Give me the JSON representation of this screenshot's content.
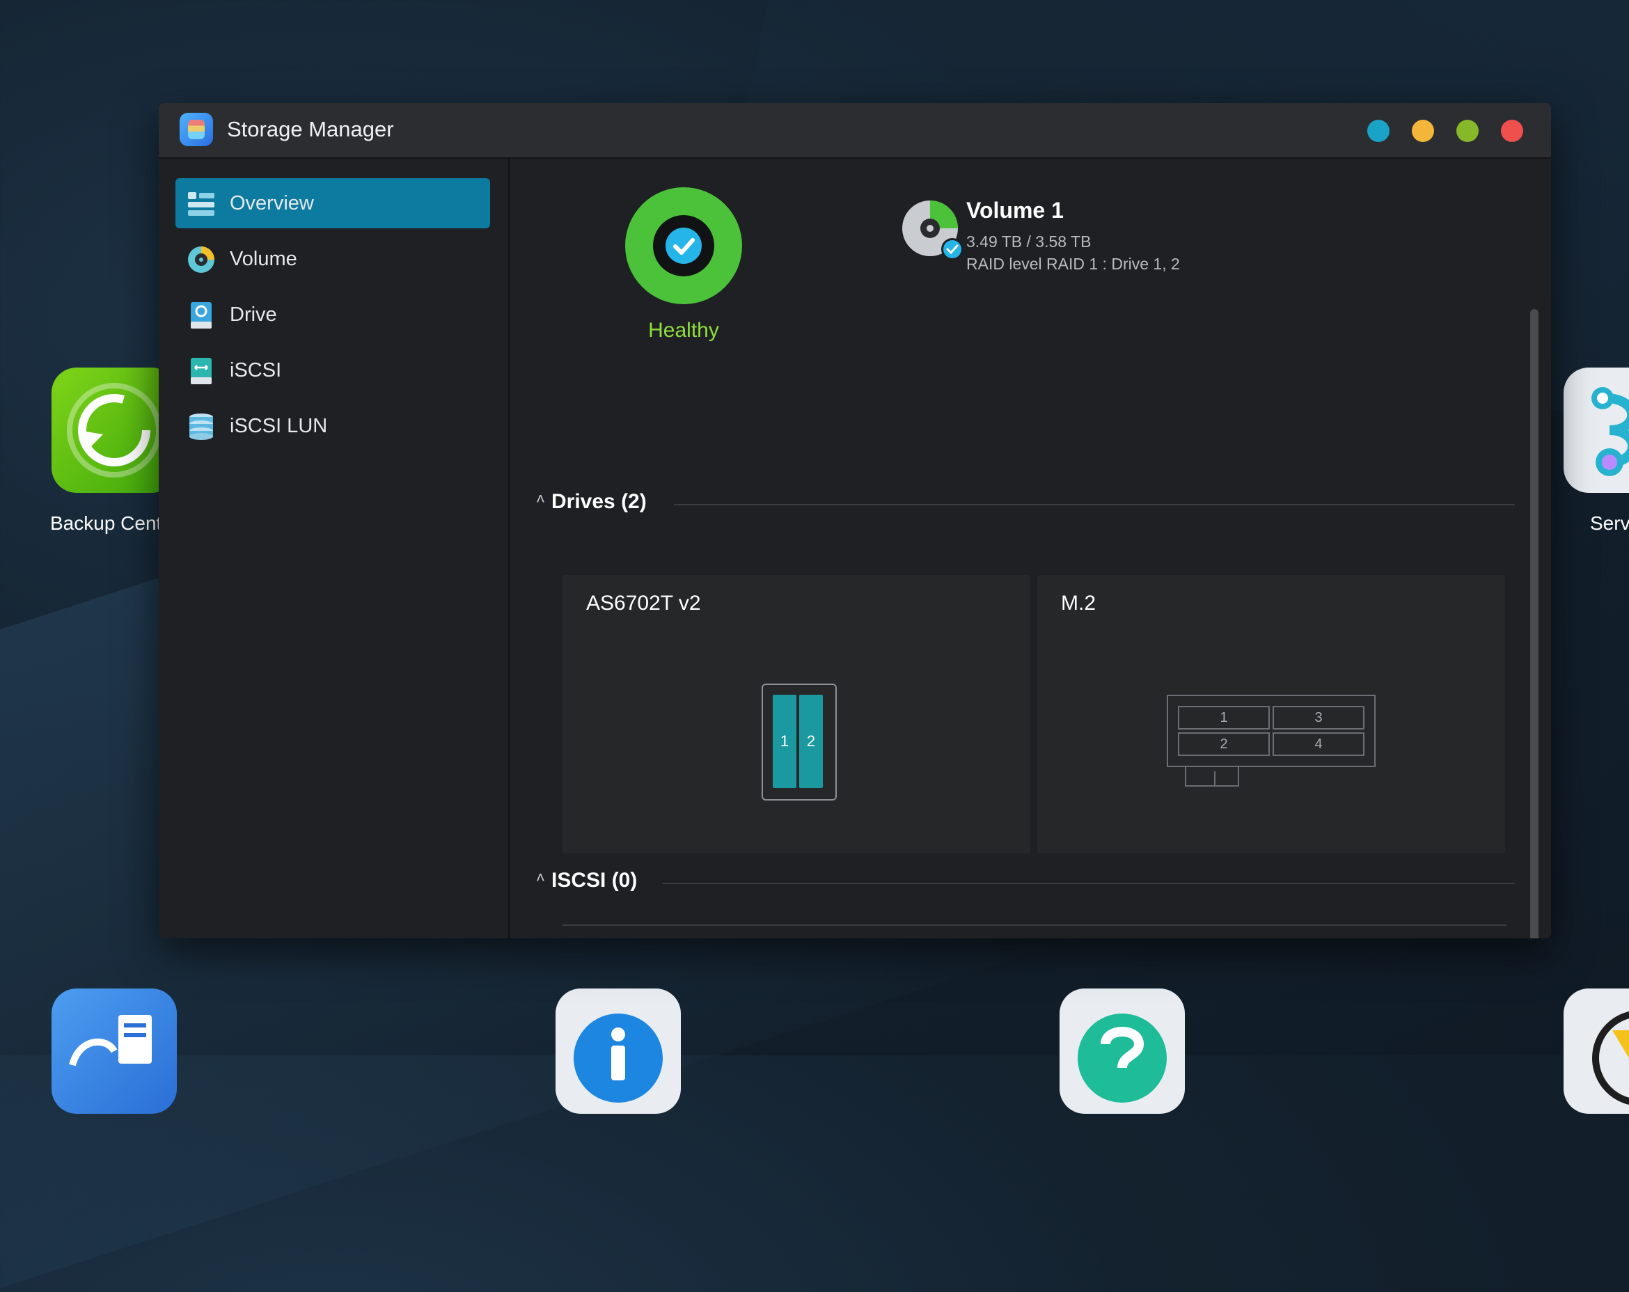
{
  "desktop": {
    "backup_label": "Backup Centr",
    "services_label": "Serv"
  },
  "window": {
    "title": "Storage Manager",
    "traffic_lights": [
      "#1aa2c7",
      "#f4b63a",
      "#86b82a",
      "#f0504d"
    ]
  },
  "sidebar": {
    "items": [
      {
        "label": "Overview",
        "icon": "overview-icon",
        "active": true
      },
      {
        "label": "Volume",
        "icon": "volume-icon",
        "active": false
      },
      {
        "label": "Drive",
        "icon": "drive-icon",
        "active": false
      },
      {
        "label": "iSCSI",
        "icon": "iscsi-icon",
        "active": false
      },
      {
        "label": "iSCSI LUN",
        "icon": "iscsi-lun-icon",
        "active": false
      }
    ]
  },
  "overview": {
    "status": "Healthy",
    "status_color": "#8fe03a",
    "volume": {
      "name": "Volume 1",
      "usage": "3.49 TB / 3.58 TB",
      "raid": "RAID level RAID 1 : Drive 1, 2"
    }
  },
  "drives": {
    "header": "Drives (2)",
    "cards": [
      {
        "title": "AS6702T v2",
        "bays": [
          "1",
          "2"
        ]
      },
      {
        "title": "M.2",
        "slots": [
          "1",
          "3",
          "2",
          "4"
        ]
      }
    ]
  },
  "iscsi": {
    "header": "ISCSI (0)"
  }
}
